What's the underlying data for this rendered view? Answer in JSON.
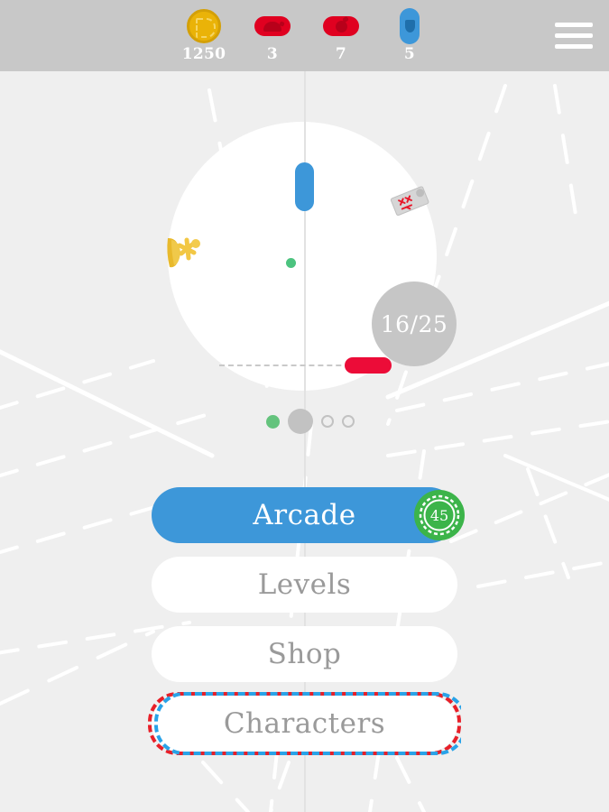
{
  "hud": {
    "items": [
      {
        "icon": "coin-icon",
        "name": "coins",
        "count": "1250",
        "color": "#eab308"
      },
      {
        "icon": "snail-icon",
        "name": "snails",
        "count": "3",
        "color": "#e00020"
      },
      {
        "icon": "bomb-icon",
        "name": "bombs",
        "count": "7",
        "color": "#e00020"
      },
      {
        "icon": "shield-icon",
        "name": "shields",
        "count": "5",
        "color": "#3d97d9"
      }
    ],
    "bar_color": "#c8c8c8",
    "menu_icon": "hamburger-menu-icon"
  },
  "arena": {
    "score": "16/25",
    "ball_color": "#4cc37f",
    "paddle_top_color": "#3d97d9",
    "paddle_bottom_color": "#ec0c38",
    "score_bubble_color": "#c6c6c6",
    "powerup_icon": "mine-tag-icon",
    "character_icon": "yellow-character-icon"
  },
  "pagination": {
    "dots": [
      {
        "state": "completed",
        "color": "#64c37d"
      },
      {
        "state": "active",
        "color": "#c2c2c2"
      },
      {
        "state": "inactive",
        "color": "#c2c2c2"
      },
      {
        "state": "inactive",
        "color": "#c2c2c2"
      }
    ]
  },
  "menu": {
    "arcade": {
      "label": "Arcade",
      "badge": "45",
      "badge_color": "#3cb44a",
      "bg": "#3d97d9"
    },
    "levels": {
      "label": "Levels"
    },
    "shop": {
      "label": "Shop"
    },
    "characters": {
      "label": "Characters",
      "dash_red": "#e81f28",
      "dash_blue": "#29a3e8"
    }
  },
  "theme": {
    "background": "#efefef",
    "arena_fill": "#ffffff",
    "line_color": "#ffffff"
  }
}
